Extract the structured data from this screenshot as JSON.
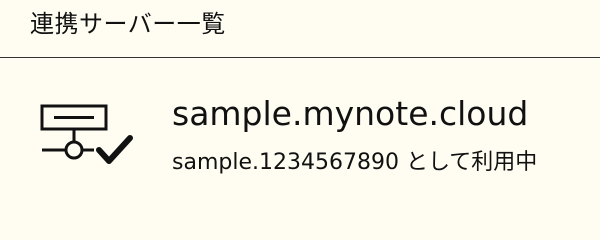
{
  "header": {
    "title": "連携サーバー一覧"
  },
  "servers": [
    {
      "icon": "server-connected-icon",
      "name": "sample.mynote.cloud",
      "status": "sample.1234567890 として利用中"
    }
  ],
  "colors": {
    "background": "#fffdf2",
    "text": "#111111",
    "divider": "#333333"
  }
}
